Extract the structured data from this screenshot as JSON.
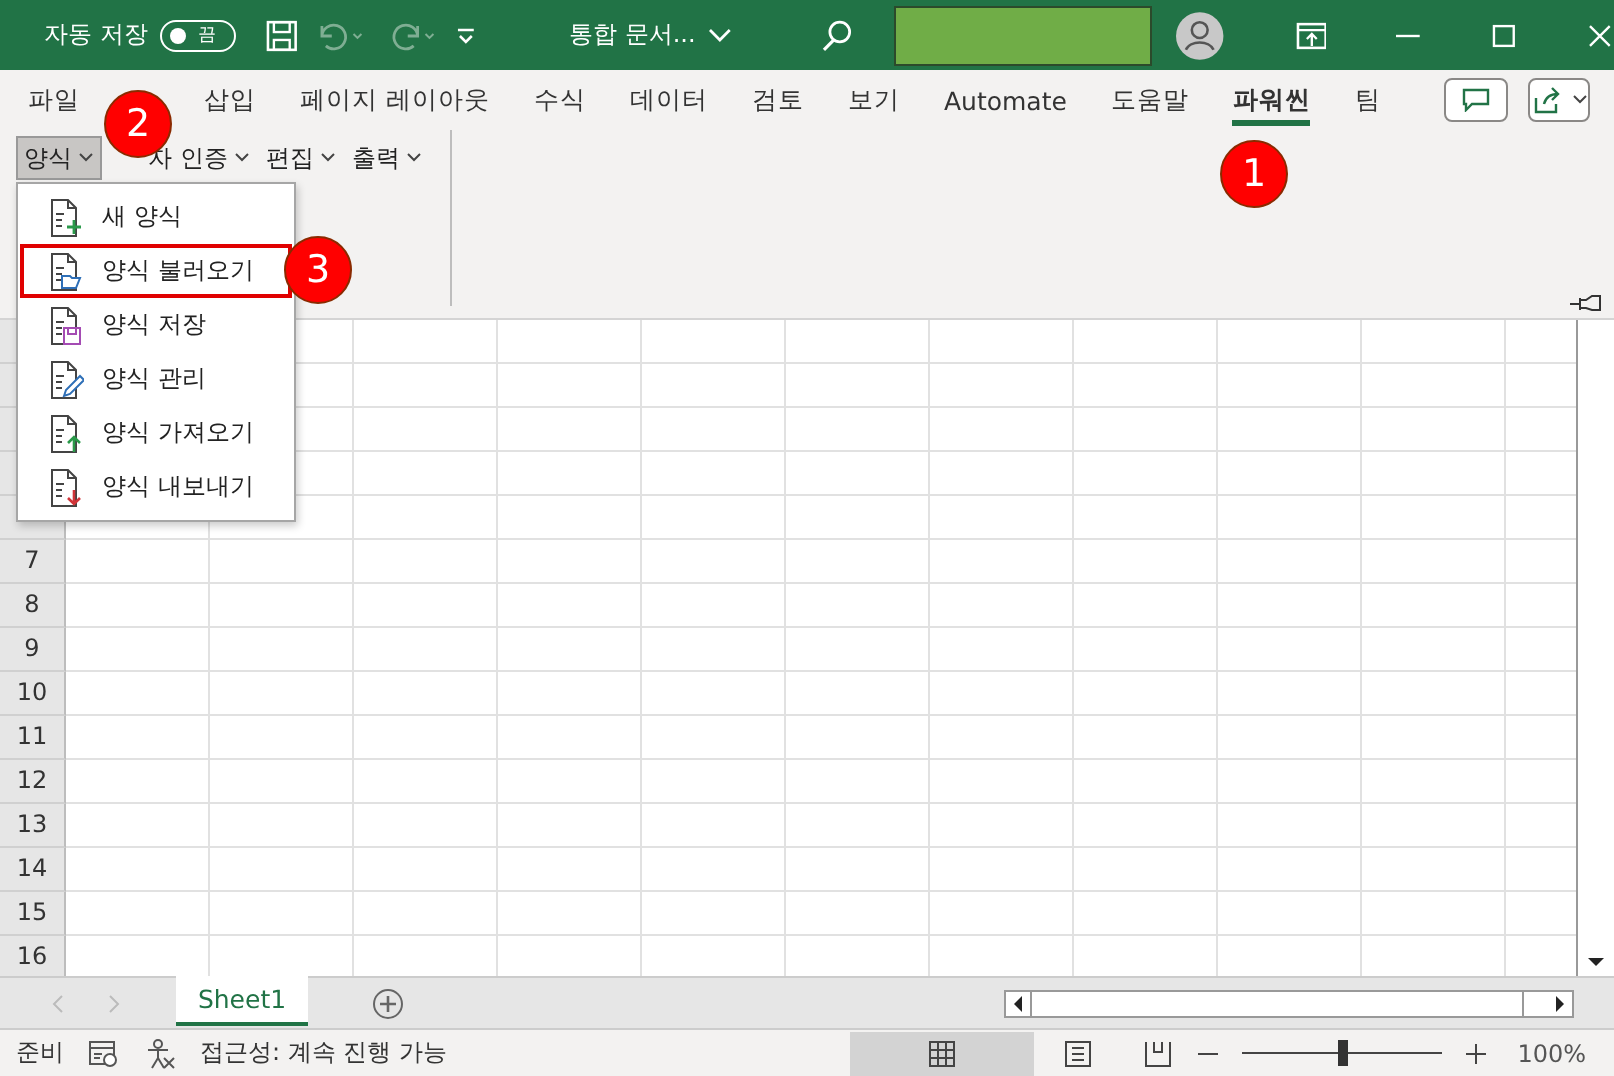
{
  "title_bar": {
    "autosave_label": "자동 저장",
    "autosave_state": "끔",
    "autosave_on": false,
    "document_title": "통합 문서..."
  },
  "ribbon_tabs": [
    {
      "label": "파일",
      "selected": false
    },
    {
      "label": "삽입",
      "selected": false
    },
    {
      "label": "페이지 레이아웃",
      "selected": false
    },
    {
      "label": "수식",
      "selected": false
    },
    {
      "label": "데이터",
      "selected": false
    },
    {
      "label": "검토",
      "selected": false
    },
    {
      "label": "보기",
      "selected": false
    },
    {
      "label": "Automate",
      "selected": false
    },
    {
      "label": "도움말",
      "selected": false
    },
    {
      "label": "파워씬",
      "selected": true
    },
    {
      "label": "팀",
      "selected": false
    }
  ],
  "commands": [
    {
      "label": "양식",
      "selected": true
    },
    {
      "label": "자 인증",
      "selected": false
    },
    {
      "label": "편집",
      "selected": false
    },
    {
      "label": "출력",
      "selected": false
    }
  ],
  "menu": {
    "items": [
      {
        "label": "새 양식",
        "kind": "new",
        "selected": false
      },
      {
        "label": "양식 불러오기",
        "kind": "open",
        "selected": true
      },
      {
        "label": "양식 저장",
        "kind": "save",
        "selected": false
      },
      {
        "label": "양식 관리",
        "kind": "edit",
        "selected": false
      },
      {
        "label": "양식 가져오기",
        "kind": "import",
        "selected": false
      },
      {
        "label": "양식 내보내기",
        "kind": "export",
        "selected": false
      }
    ]
  },
  "callouts": [
    "1",
    "2",
    "3"
  ],
  "grid": {
    "row_numbers": [
      "7",
      "8",
      "9",
      "10",
      "11",
      "12",
      "13",
      "14",
      "15",
      "16"
    ]
  },
  "sheet_tabs": [
    {
      "label": "Sheet1",
      "selected": true
    }
  ],
  "status_bar": {
    "ready": "준비",
    "accessibility": "접근성: 계속 진행 가능",
    "zoom": "100%",
    "zoom_slider": {
      "level": 0.5
    }
  }
}
